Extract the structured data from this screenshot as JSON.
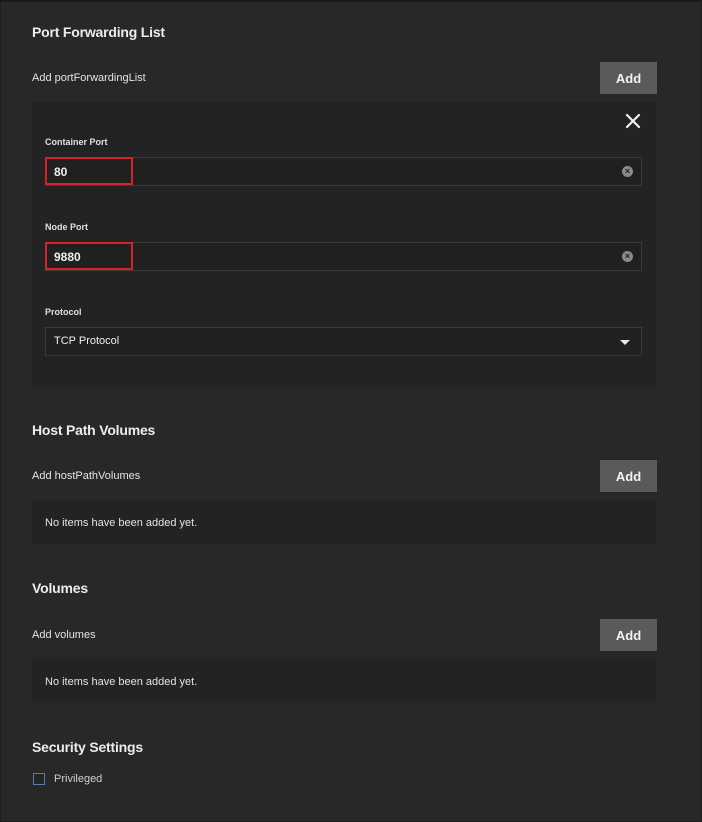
{
  "port_forwarding": {
    "title": "Port Forwarding List",
    "add_label": "Add portForwardingList",
    "add_button": "Add",
    "item": {
      "container_port_label": "Container Port",
      "container_port_value": "80",
      "node_port_label": "Node Port",
      "node_port_value": "9880",
      "protocol_label": "Protocol",
      "protocol_value": "TCP Protocol"
    }
  },
  "host_path_volumes": {
    "title": "Host Path Volumes",
    "add_label": "Add hostPathVolumes",
    "add_button": "Add",
    "empty_text": "No items have been added yet."
  },
  "volumes": {
    "title": "Volumes",
    "add_label": "Add volumes",
    "add_button": "Add",
    "empty_text": "No items have been added yet."
  },
  "security": {
    "title": "Security Settings",
    "privileged_label": "Privileged",
    "privileged_checked": false
  },
  "colors": {
    "background": "#282828",
    "panel": "#232323",
    "button": "#5a5a5a",
    "highlight": "#d8212a",
    "checkbox_border": "#5a7fa6"
  },
  "icons": {
    "close": "close-icon",
    "clear": "clear-input-icon",
    "dropdown": "chevron-down-icon"
  }
}
